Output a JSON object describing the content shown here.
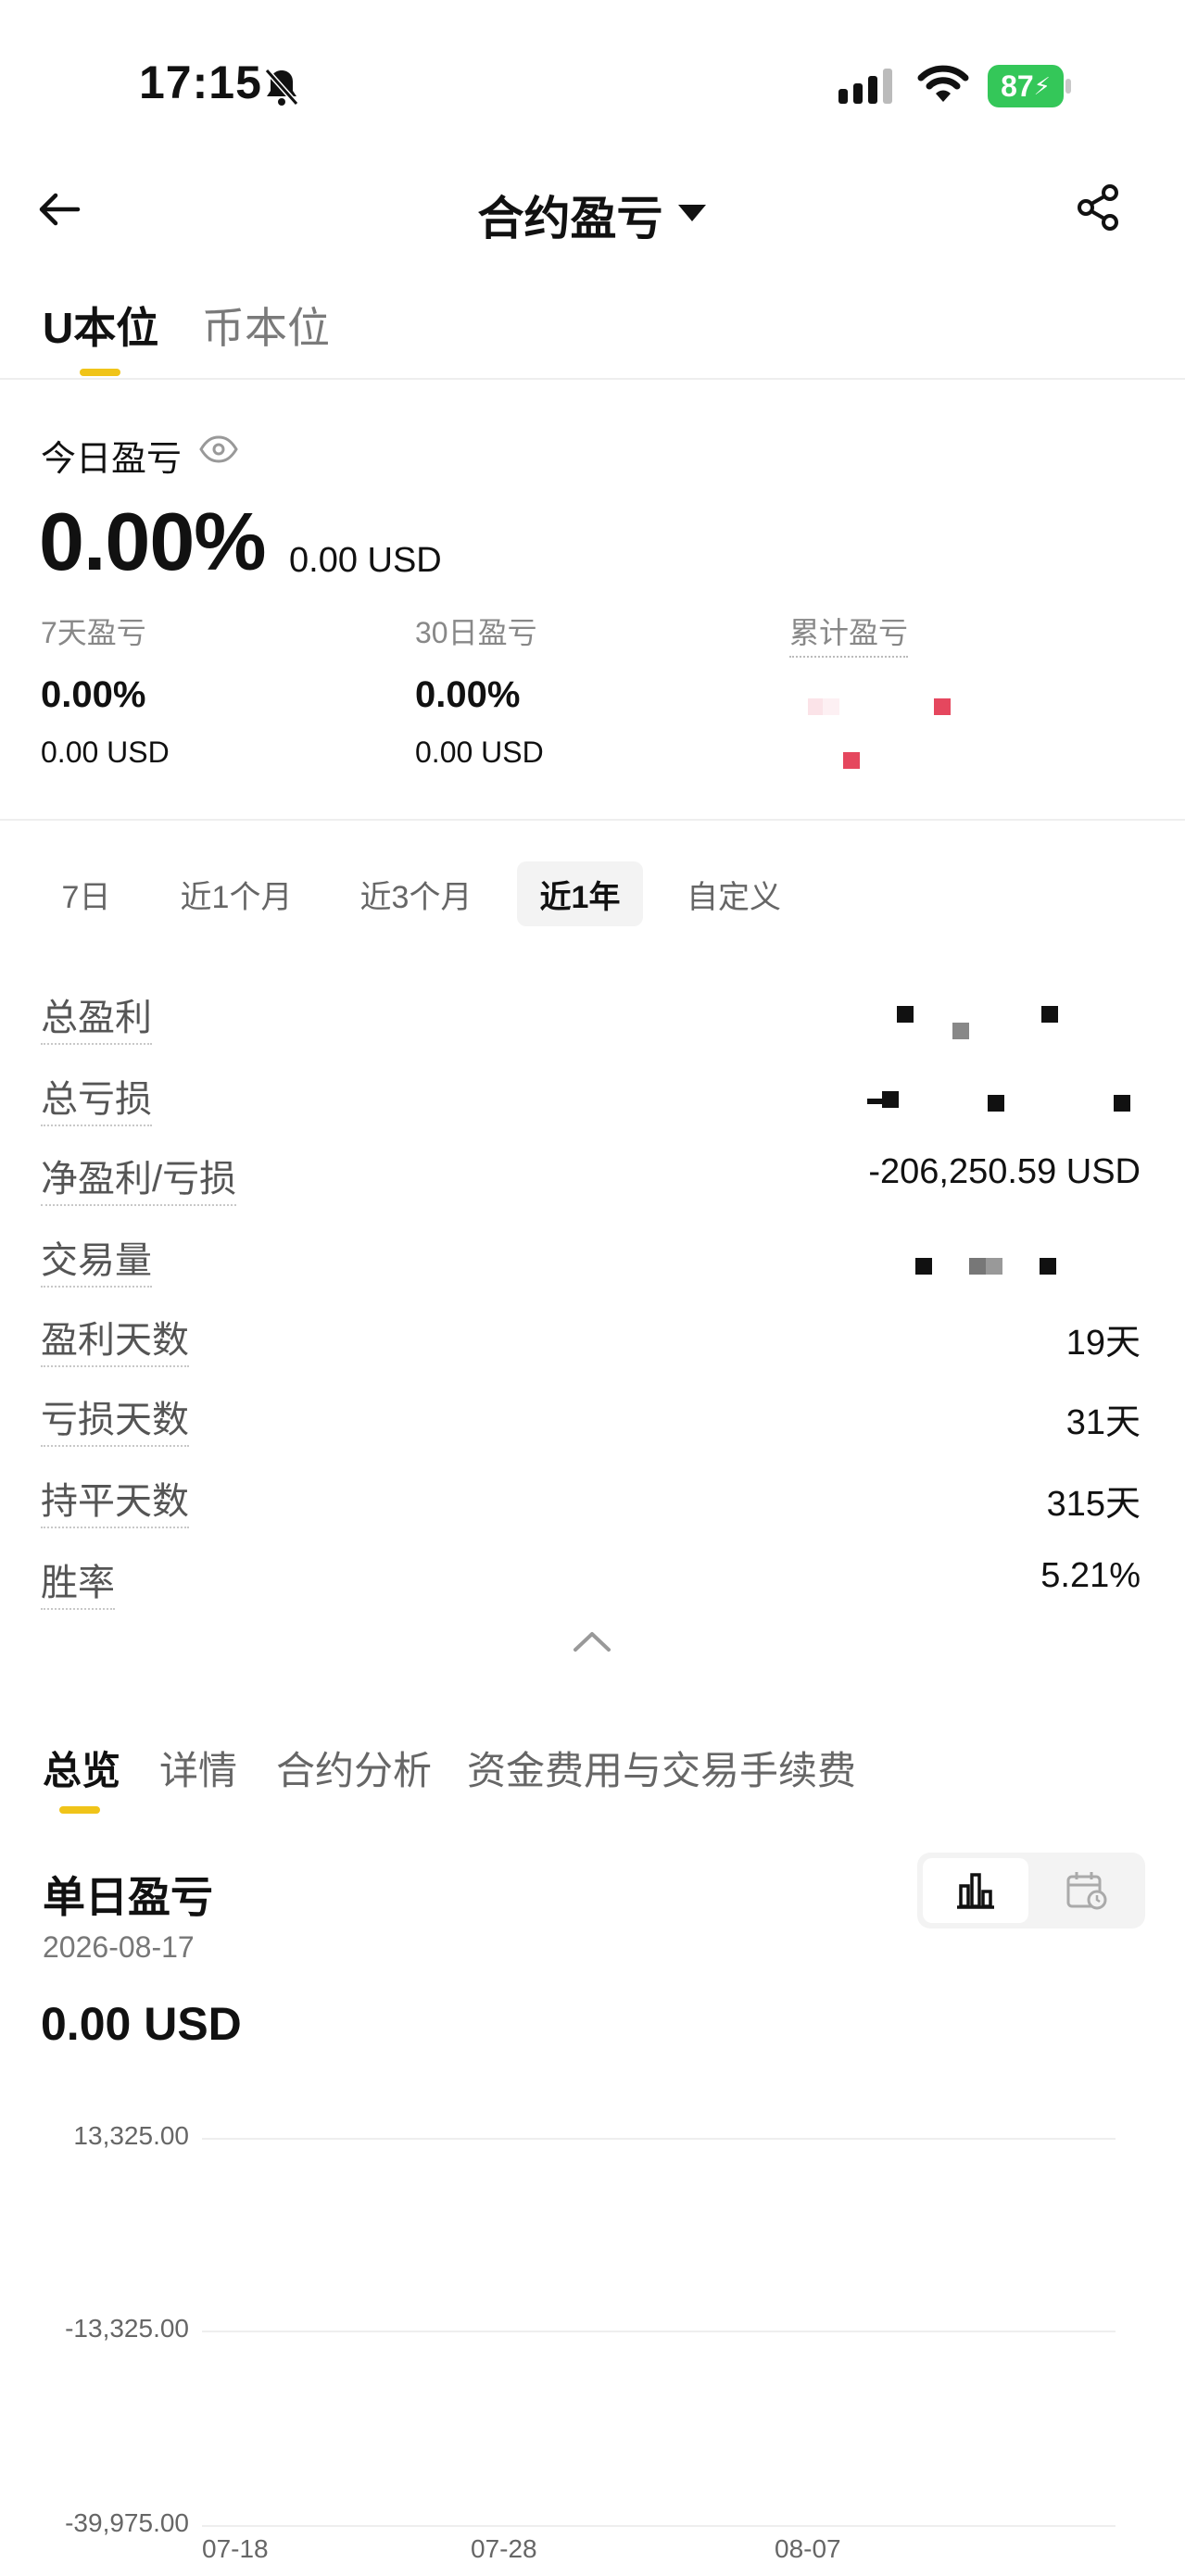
{
  "status_bar": {
    "time": "17:15",
    "battery": "87",
    "icons": [
      "bell-slash-icon",
      "cellular-signal-icon",
      "wifi-icon",
      "battery-icon"
    ]
  },
  "header": {
    "title": "合约盈亏",
    "icons": [
      "back-arrow-icon",
      "caret-down-icon",
      "share-icon"
    ]
  },
  "top_tabs": [
    {
      "label": "U本位",
      "active": true
    },
    {
      "label": "币本位",
      "active": false
    }
  ],
  "today": {
    "label": "今日盈亏",
    "pct": "0.00%",
    "usd": "0.00 USD"
  },
  "stats": [
    {
      "label": "7天盈亏",
      "pct": "0.00%",
      "usd": "0.00 USD"
    },
    {
      "label": "30日盈亏",
      "pct": "0.00%",
      "usd": "0.00 USD"
    },
    {
      "label": "累计盈亏",
      "pct": "",
      "usd": ""
    }
  ],
  "ranges": [
    {
      "label": "7日",
      "active": false
    },
    {
      "label": "近1个月",
      "active": false
    },
    {
      "label": "近3个月",
      "active": false
    },
    {
      "label": "近1年",
      "active": true
    },
    {
      "label": "自定义",
      "active": false
    }
  ],
  "metrics": [
    {
      "label": "总盈利",
      "value": ""
    },
    {
      "label": "总亏损",
      "value": ""
    },
    {
      "label": "净盈利/亏损",
      "value": "-206,250.59 USD"
    },
    {
      "label": "交易量",
      "value": ""
    },
    {
      "label": "盈利天数",
      "value": "19天"
    },
    {
      "label": "亏损天数",
      "value": "31天"
    },
    {
      "label": "持平天数",
      "value": "315天"
    },
    {
      "label": "胜率",
      "value": "5.21%"
    }
  ],
  "bottom_tabs": [
    {
      "label": "总览",
      "active": true
    },
    {
      "label": "详情",
      "active": false
    },
    {
      "label": "合约分析",
      "active": false
    },
    {
      "label": "资金费用与交易手续费",
      "active": false
    }
  ],
  "daily": {
    "title": "单日盈亏",
    "date": "2026-08-17",
    "value": "0.00 USD"
  },
  "chart_data": {
    "type": "bar",
    "y_ticks": [
      "13,325.00",
      "-13,325.00",
      "-39,975.00"
    ],
    "x_ticks": [
      "07-18",
      "07-28",
      "08-07"
    ],
    "grid": true
  },
  "colors": {
    "accent": "#f0c419",
    "battery": "#34c759",
    "masked_red": "#e5475e"
  }
}
